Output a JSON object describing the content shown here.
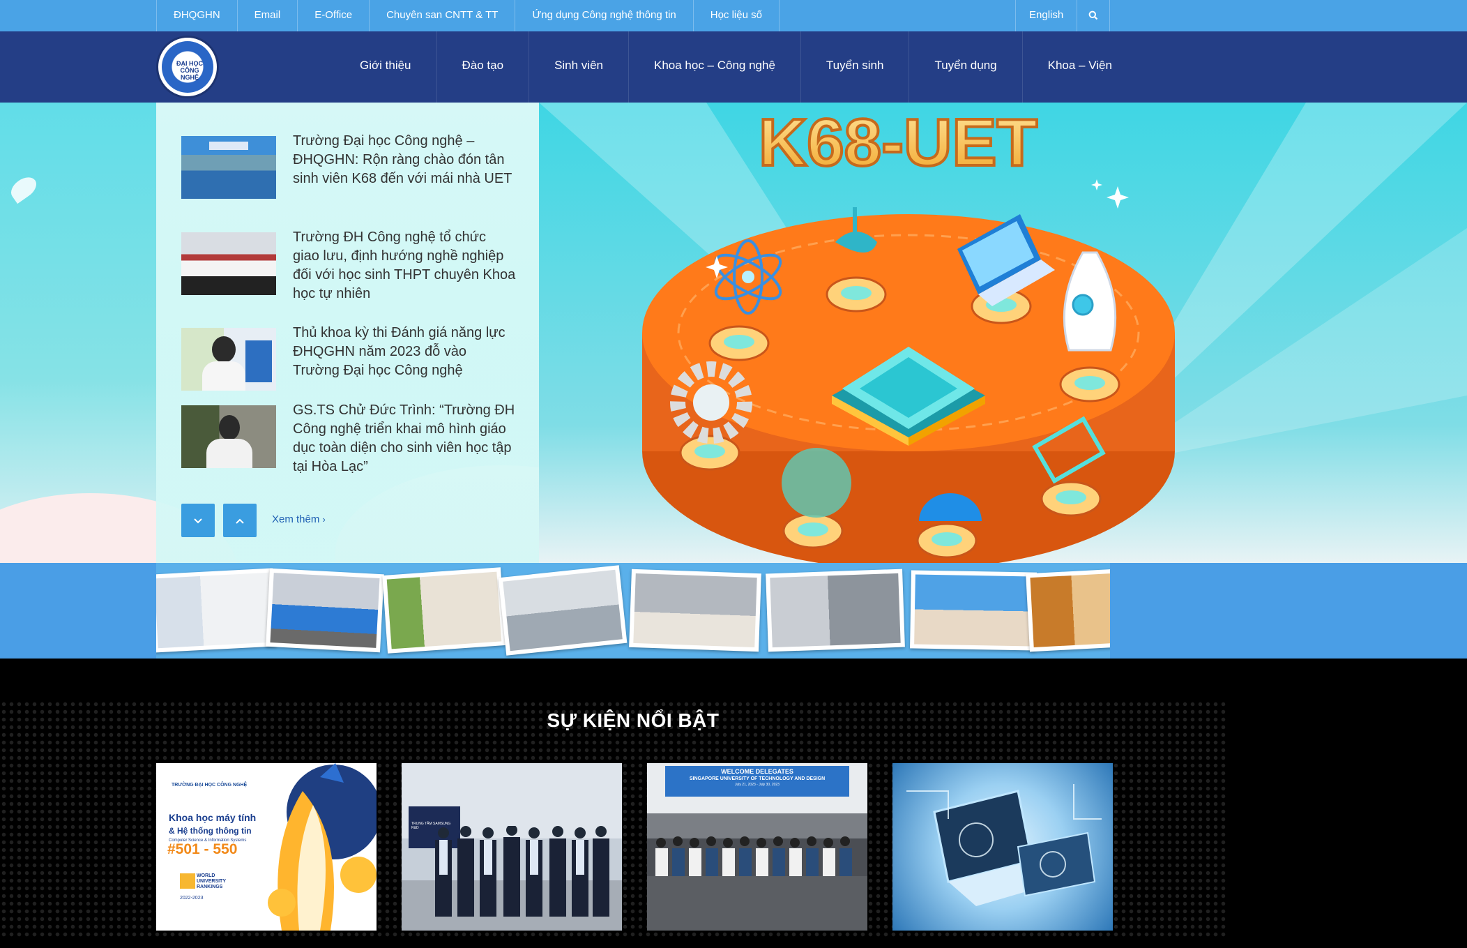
{
  "topbar": {
    "links": [
      "ĐHQGHN",
      "Email",
      "E-Office",
      "Chuyên san CNTT & TT",
      "Ứng dụng Công nghệ thông tin",
      "Học liệu số"
    ],
    "language": "English",
    "search_icon": "search-icon"
  },
  "logo": {
    "text": "ĐẠI HỌC CÔNG NGHỆ"
  },
  "nav": {
    "items": [
      "Giới thiệu",
      "Đào tạo",
      "Sinh viên",
      "Khoa học – Công nghệ",
      "Tuyển sinh",
      "Tuyển dụng",
      "Khoa – Viện"
    ]
  },
  "news": {
    "items": [
      {
        "title": "Trường Đại học Công nghệ – ĐHQGHN: Rộn ràng chào đón tân sinh viên K68 đến với mái nhà UET"
      },
      {
        "title": "Trường ĐH Công nghệ tổ chức giao lưu, định hướng nghề nghiệp đối với học sinh THPT chuyên Khoa học tự nhiên"
      },
      {
        "title": "Thủ khoa kỳ thi Đánh giá năng lực ĐHQGHN năm 2023 đỗ vào Trường Đại học Công nghệ"
      },
      {
        "title": "GS.TS Chử Đức Trình: “Trường ĐH Công nghệ triển khai mô hình giáo dục toàn diện cho sinh viên học tập tại Hòa Lạc”"
      }
    ],
    "down_icon": "chevron-down-icon",
    "up_icon": "chevron-up-icon",
    "more_label": "Xem thêm"
  },
  "banner": {
    "title": "K68-UET"
  },
  "events": {
    "heading": "SỰ KIỆN NỔI BẬT",
    "cards": [
      {
        "poster_lines": [
          "Khoa học máy tính",
          "& Hệ thống thông tin",
          "Computer Science & Information Systems",
          "#501 - 550"
        ],
        "poster_header": "TRƯỜNG ĐẠI HỌC CÔNG NGHỆ",
        "rank_label": "WORLD UNIVERSITY RANKINGS",
        "rank_years": "2022-2023"
      },
      {
        "sign": "TRUNG TÂM SAMSUNG R&D"
      },
      {
        "sign_line1": "WELCOME DELEGATES",
        "sign_line2": "SINGAPORE UNIVERSITY OF TECHNOLOGY AND DESIGN",
        "sign_line3": "July 21, 2023 - July 30, 2023"
      },
      {}
    ]
  },
  "colors": {
    "topbar": "#4aa3e6",
    "nav": "#243e86",
    "accent": "#3a9de0",
    "banner_orange": "#ff7a1a"
  }
}
